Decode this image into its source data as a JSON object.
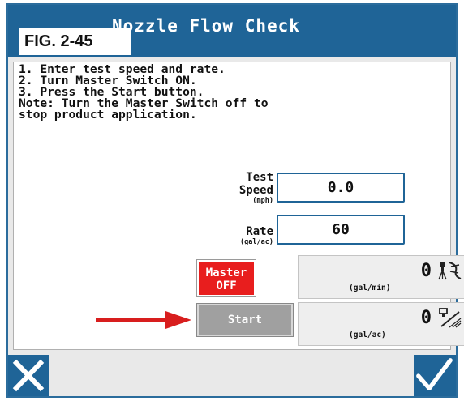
{
  "title": "Nozzle Flow Check",
  "figure_label": "FIG. 2-45",
  "instructions": [
    "1. Enter test speed and rate.",
    "2. Turn Master Switch ON.",
    "3. Press the Start button.",
    "Note: Turn the Master Switch off to",
    "stop product application."
  ],
  "test_speed": {
    "label_line1": "Test",
    "label_line2": "Speed",
    "unit": "(mph)",
    "value": "0.0"
  },
  "rate": {
    "label": "Rate",
    "unit": "(gal/ac)",
    "value": "60"
  },
  "master": {
    "line1": "Master",
    "line2": "OFF"
  },
  "start_label": "Start",
  "flow_readout": {
    "value": "0",
    "unit": "(gal/min)",
    "icon": "nozzle-spray-icon"
  },
  "applied_readout": {
    "value": "0",
    "unit": "(gal/ac)",
    "icon": "nozzle-area-icon"
  },
  "footer": {
    "cancel_icon": "close-icon",
    "confirm_icon": "checkmark-icon"
  },
  "colors": {
    "title_bar": "#1f6497",
    "master_off": "#e81e1e",
    "start_button": "#a0a0a0",
    "arrow": "#d81e1e"
  }
}
